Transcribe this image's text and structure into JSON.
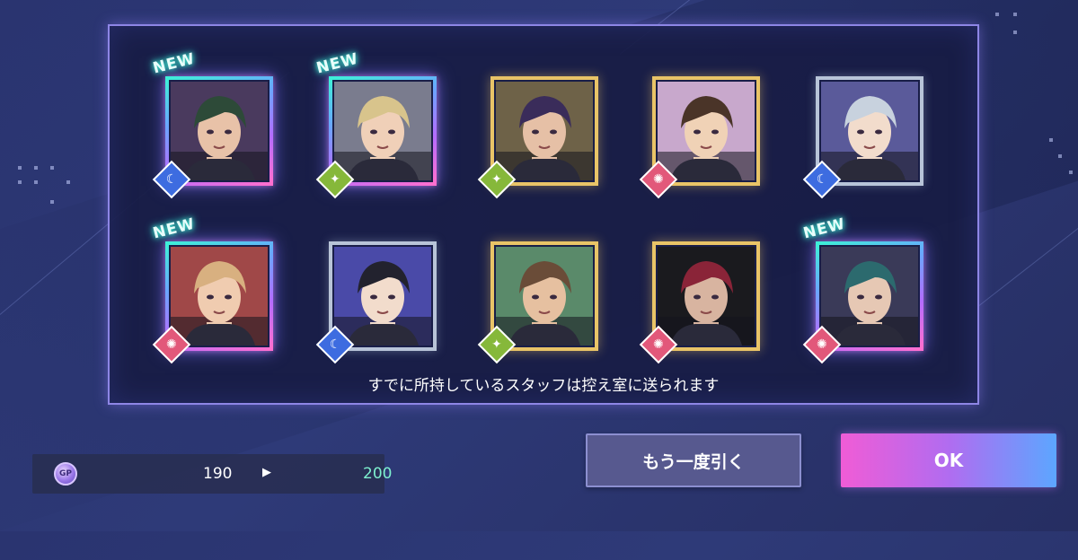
{
  "cards": [
    {
      "is_new": true,
      "attribute": "moon-icon",
      "rarity": "rainbow",
      "hair": "#2d4a38",
      "skin": "#e8c2a8",
      "bg": "#4a3a5e"
    },
    {
      "is_new": true,
      "attribute": "star-icon",
      "rarity": "rainbow",
      "hair": "#d8c48c",
      "skin": "#f0d0b8",
      "bg": "#7a7c8e"
    },
    {
      "is_new": false,
      "attribute": "star-icon",
      "rarity": "gold",
      "hair": "#3a2c5a",
      "skin": "#e6c0a6",
      "bg": "#6e6248"
    },
    {
      "is_new": false,
      "attribute": "sun-icon",
      "rarity": "gold",
      "hair": "#4a3428",
      "skin": "#f0d2b6",
      "bg": "#c8a8cc"
    },
    {
      "is_new": false,
      "attribute": "moon-icon",
      "rarity": "silver",
      "hair": "#c8d2de",
      "skin": "#f2dccc",
      "bg": "#5a5a9a"
    },
    {
      "is_new": true,
      "attribute": "sun-icon",
      "rarity": "rainbow",
      "hair": "#d8b080",
      "skin": "#f0ccb0",
      "bg": "#a04848"
    },
    {
      "is_new": false,
      "attribute": "moon-icon",
      "rarity": "silver",
      "hair": "#22222e",
      "skin": "#f2dccc",
      "bg": "#4a4aa8"
    },
    {
      "is_new": false,
      "attribute": "star-icon",
      "rarity": "gold",
      "hair": "#6a4c38",
      "skin": "#e6c0a0",
      "bg": "#5a8a6a"
    },
    {
      "is_new": false,
      "attribute": "sun-icon",
      "rarity": "gold",
      "hair": "#8a2438",
      "skin": "#d8b4a0",
      "bg": "#1a1a1e"
    },
    {
      "is_new": true,
      "attribute": "sun-icon",
      "rarity": "rainbow",
      "hair": "#2c6a6e",
      "skin": "#e6c8b4",
      "bg": "#3a3a58"
    }
  ],
  "new_label": "NEW",
  "notice": "すでに所持しているスタッフは控え室に送られます",
  "gp": {
    "icon": "gp-coin-icon",
    "icon_label": "GP",
    "from": "190",
    "arrow": "▶",
    "to": "200"
  },
  "buttons": {
    "retry": "もう一度引く",
    "ok": "OK"
  },
  "colors": {
    "accent_panel_border": "#8e86e6",
    "gp_new_value": "#7ef0cf",
    "moon": "#3d6ce0",
    "star": "#86b83a",
    "sun": "#e2587a"
  }
}
